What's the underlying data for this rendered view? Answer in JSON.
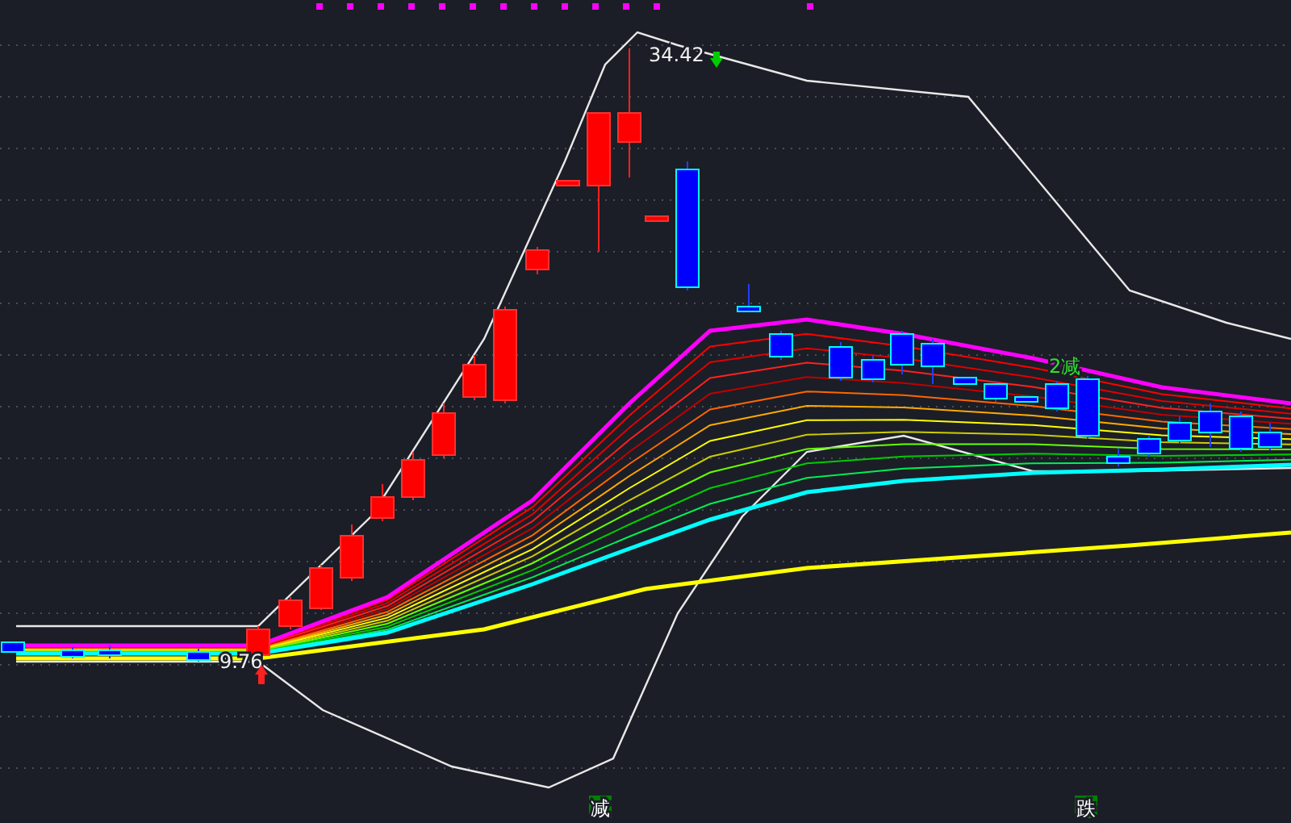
{
  "chart": {
    "high_label": "34.42",
    "low_label": "9.76",
    "signal_label": "2减"
  },
  "bottom_markers": [
    {
      "label": "减"
    },
    {
      "label": "跌"
    }
  ]
}
